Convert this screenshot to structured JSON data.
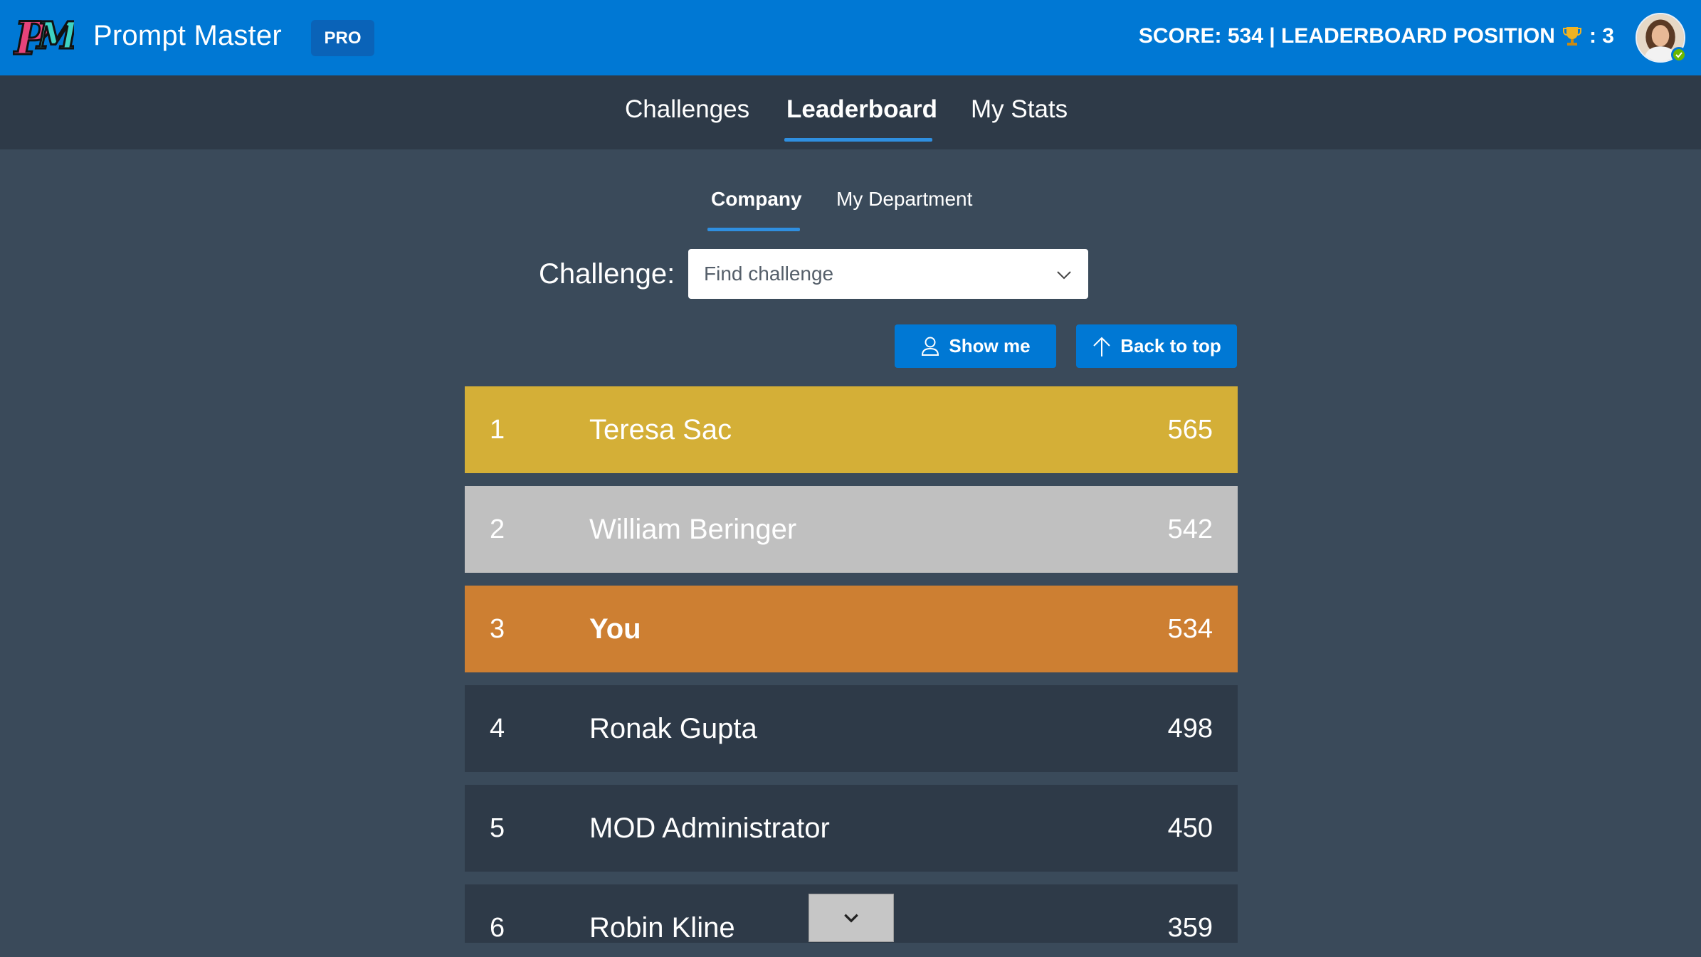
{
  "app": {
    "title": "Prompt Master",
    "badge": "PRO",
    "score_text": "SCORE: 534 | LEADERBOARD POSITION",
    "position_text": ": 3",
    "brand_color": "#0078d4"
  },
  "mainnav": {
    "tabs": [
      {
        "label": "Challenges"
      },
      {
        "label": "Leaderboard"
      },
      {
        "label": "My Stats"
      }
    ],
    "active": "Leaderboard"
  },
  "subtabs": {
    "tabs": [
      {
        "label": "Company"
      },
      {
        "label": "My Department"
      }
    ],
    "active": "Company"
  },
  "filter": {
    "label": "Challenge:",
    "placeholder": "Find challenge"
  },
  "actions": {
    "show_me": "Show me",
    "back_to_top": "Back to top"
  },
  "leaderboard": {
    "rows": [
      {
        "rank": "1",
        "name": "Teresa Sac",
        "score": "565",
        "color": "#d4af37"
      },
      {
        "rank": "2",
        "name": "William Beringer",
        "score": "542",
        "color": "#c0c0c0"
      },
      {
        "rank": "3",
        "name": "You",
        "score": "534",
        "color": "#cd7f32"
      },
      {
        "rank": "4",
        "name": "Ronak Gupta",
        "score": "498",
        "color": "#2e3a48"
      },
      {
        "rank": "5",
        "name": "MOD Administrator",
        "score": "450",
        "color": "#2e3a48"
      },
      {
        "rank": "6",
        "name": "Robin Kline",
        "score": "359",
        "color": "#2e3a48"
      }
    ]
  },
  "icons": {
    "logo": "pm-logo-icon",
    "trophy": "trophy-icon",
    "dropdown": "chevron-down-icon",
    "show_me": "person-icon",
    "back_to_top": "arrow-up-icon",
    "scroll": "chevron-down-icon"
  }
}
